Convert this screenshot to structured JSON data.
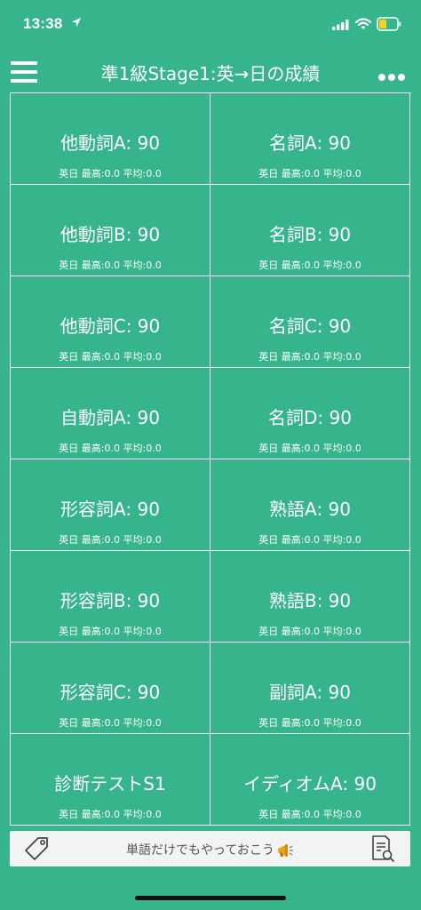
{
  "status_bar": {
    "time": "13:38",
    "icons": [
      "location-arrow-icon",
      "signal-icon",
      "wifi-icon",
      "battery-icon"
    ]
  },
  "nav": {
    "title": "準1級Stage1:英→日の成績",
    "left_icon": "hamburger-menu-icon",
    "right_icon": "more-dots-icon"
  },
  "cells": [
    {
      "title": "他動詞A: 90",
      "stats": "英日 最高:0.0 平均:0.0"
    },
    {
      "title": "名詞A: 90",
      "stats": "英日 最高:0.0 平均:0.0"
    },
    {
      "title": "他動詞B: 90",
      "stats": "英日 最高:0.0 平均:0.0"
    },
    {
      "title": "名詞B: 90",
      "stats": "英日 最高:0.0 平均:0.0"
    },
    {
      "title": "他動詞C: 90",
      "stats": "英日 最高:0.0 平均:0.0"
    },
    {
      "title": "名詞C: 90",
      "stats": "英日 最高:0.0 平均:0.0"
    },
    {
      "title": "自動詞A: 90",
      "stats": "英日 最高:0.0 平均:0.0"
    },
    {
      "title": "名詞D: 90",
      "stats": "英日 最高:0.0 平均:0.0"
    },
    {
      "title": "形容詞A: 90",
      "stats": "英日 最高:0.0 平均:0.0"
    },
    {
      "title": "熟語A: 90",
      "stats": "英日 最高:0.0 平均:0.0"
    },
    {
      "title": "形容詞B: 90",
      "stats": "英日 最高:0.0 平均:0.0"
    },
    {
      "title": "熟語B: 90",
      "stats": "英日 最高:0.0 平均:0.0"
    },
    {
      "title": "形容詞C: 90",
      "stats": "英日 最高:0.0 平均:0.0"
    },
    {
      "title": "副詞A: 90",
      "stats": "英日 最高:0.0 平均:0.0"
    },
    {
      "title": "診断テストS1",
      "stats": "英日 最高:0.0 平均:0.0"
    },
    {
      "title": "イディオムA: 90",
      "stats": "英日 最高:0.0 平均:0.0"
    }
  ],
  "banner": {
    "text": "単語だけでもやっておこう",
    "left_icon": "tag-icon",
    "inline_icon": "megaphone-icon",
    "right_icon": "document-search-icon"
  },
  "colors": {
    "background": "#36b48b",
    "foreground": "#ffffff",
    "banner_bg": "#f3f3f3",
    "battery_fill": "#f7d21b"
  }
}
